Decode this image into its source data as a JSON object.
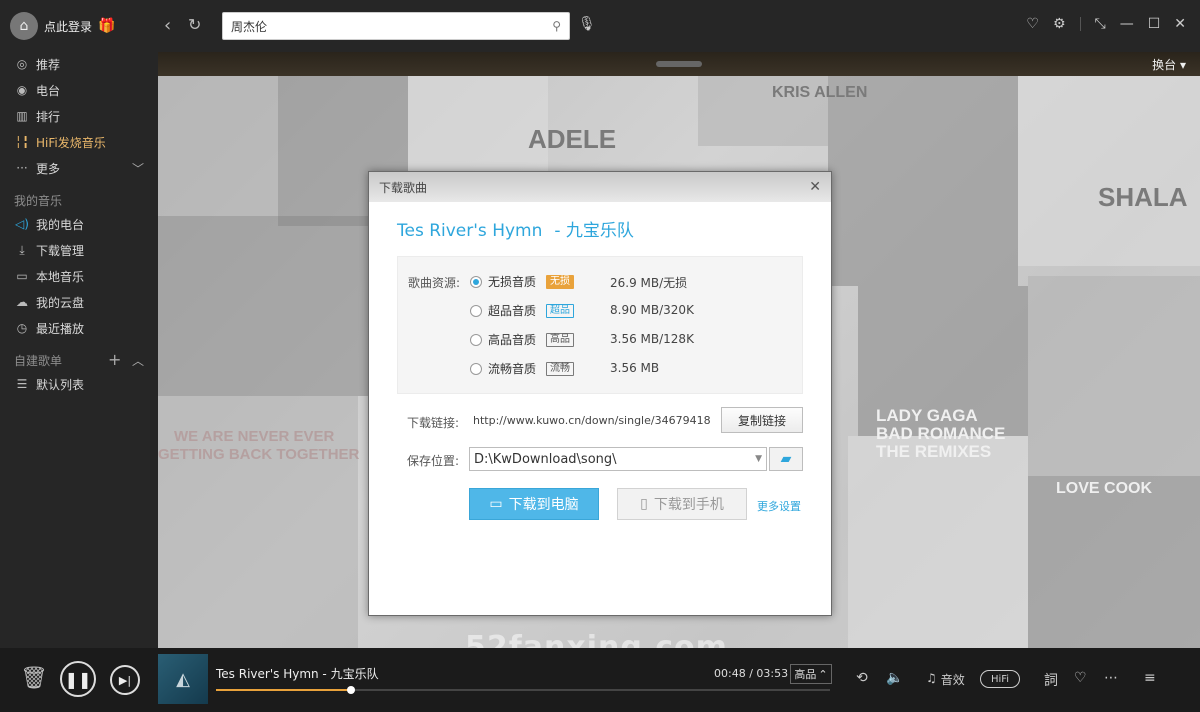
{
  "sidebar": {
    "login": "点此登录",
    "nav": [
      {
        "label": "推荐",
        "icon": "disc-icon"
      },
      {
        "label": "电台",
        "icon": "radio-icon"
      },
      {
        "label": "排行",
        "icon": "ranking-icon"
      },
      {
        "label": "HiFi发烧音乐",
        "icon": "hifi-wave-icon"
      },
      {
        "label": "更多",
        "icon": "dots-icon"
      }
    ],
    "my_music_title": "我的音乐",
    "my_music": [
      {
        "label": "我的电台",
        "icon": "speaker-icon"
      },
      {
        "label": "下载管理",
        "icon": "download-icon"
      },
      {
        "label": "本地音乐",
        "icon": "monitor-icon"
      },
      {
        "label": "我的云盘",
        "icon": "cloud-icon"
      },
      {
        "label": "最近播放",
        "icon": "clock-icon"
      }
    ],
    "playlist_title": "自建歌单",
    "playlists": [
      {
        "label": "默认列表",
        "icon": "list-icon"
      }
    ]
  },
  "topbar": {
    "search_value": "周杰伦"
  },
  "content": {
    "switch_label": "换台 ▾",
    "watermark": "52fanxing.com",
    "tile_texts": [
      "KRIS ALLEN",
      "ADELE",
      "LADY GAGA",
      "BAD ROMANCE",
      "THE REMIXES",
      "LOVE COOK",
      "WE ARE NEVER EVER",
      "GETTING BACK TOGETHER",
      "SHALA"
    ]
  },
  "dialog": {
    "title": "下载歌曲",
    "song": "Tes River's Hymn",
    "artist": "- 九宝乐队",
    "quality_label": "歌曲资源:",
    "qualities": [
      {
        "name": "无损音质",
        "badge": "无损",
        "size": "26.9 MB/无损",
        "checked": true
      },
      {
        "name": "超品音质",
        "badge": "超品",
        "size": "8.90 MB/320K",
        "checked": false
      },
      {
        "name": "高品音质",
        "badge": "高品",
        "size": "3.56 MB/128K",
        "checked": false
      },
      {
        "name": "流畅音质",
        "badge": "流畅",
        "size": "3.56 MB",
        "checked": false
      }
    ],
    "link_label": "下载链接:",
    "link_url": "http://www.kuwo.cn/down/single/34679418",
    "copy_label": "复制链接",
    "path_label": "保存位置:",
    "path_value": "D:\\KwDownload\\song\\",
    "download_pc": "下载到电脑",
    "download_phone": "下载到手机",
    "more_settings": "更多设置"
  },
  "player": {
    "track": "Tes River's Hymn - 九宝乐队",
    "time": "00:48 / 03:53",
    "quality": "高品",
    "progress": 0.22,
    "sound_effect": "音效",
    "hifi": "HiFi"
  }
}
